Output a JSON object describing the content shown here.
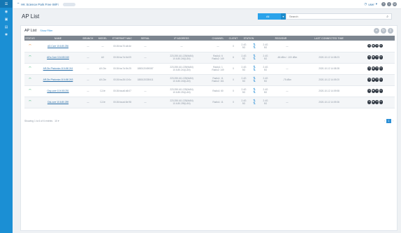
{
  "sidebar": {
    "items": [
      "nav-1",
      "nav-2",
      "nav-3",
      "nav-4",
      "nav-5"
    ]
  },
  "topbar": {
    "site": "HK Science Park Free WiFi",
    "user": "user"
  },
  "header": {
    "title": "AP List",
    "select_value": "All",
    "search_placeholder": "Search"
  },
  "panel": {
    "title": "AP List",
    "filter": "Show Filter"
  },
  "columns": [
    "STATUS",
    "NAME",
    "BRANCH",
    "MODEL",
    "ETHERNET MAC",
    "SERIAL",
    "IP ADDRESS",
    "CHANNEL",
    "CLIENT",
    "STATION",
    "",
    "RSSI/SNR",
    "",
    "LAST CONNECTED TIME",
    ""
  ],
  "rows": [
    {
      "status": "warn",
      "name": "AD-Core 10.6.80.236",
      "branch": "—",
      "model": "—",
      "mac": "00:26:ba:70:d4:6e",
      "serial": "—",
      "ip1": "—",
      "ip2": "",
      "ch1": "—",
      "ch2": "",
      "client": "0",
      "st1": "2.4G",
      "st2": "5G",
      "rssi1": "2.4G",
      "rssi2": "5G",
      "snr": "—",
      "last": ""
    },
    {
      "status": "ok",
      "name": "ADv-Core 10.6.80.240",
      "branch": "—",
      "model": "AX",
      "mac": "00:26:ba:7d:0d:09",
      "serial": "—",
      "ip1": "223.255.161.225(WAN)",
      "ip2": "10.6.80.240(LAN)",
      "ch1": "Radio1: 6",
      "ch2": "Radio2: 149",
      "client": "6",
      "st1": "2.4G",
      "st2": "5G",
      "rssi1": "2.4G",
      "rssi2": "5G",
      "snr": "-66 dBm / -100 dBm",
      "last": "2020-10-12 14:08:23"
    },
    {
      "status": "ok",
      "name": "AR-Dix Photonics 10.6.80.241",
      "branch": "—",
      "model": "AX-Dix",
      "mac": "00:26:ba:7d:0b:25",
      "serial": "1880120490087",
      "ip1": "223.255.161.225(WAN)",
      "ip2": "10.6.80.241(LAN)",
      "ch1": "Radio1: 1",
      "ch2": "Radio2: 149",
      "client": "0",
      "st1": "2.4G",
      "st2": "5G",
      "rssi1": "2.4G",
      "rssi2": "5G",
      "snr": "—",
      "last": "2020-10-12 14:08:38"
    },
    {
      "status": "ok",
      "name": "AR-Dix Photonics 10.6.80.243",
      "branch": "—",
      "model": "AX-Dix",
      "mac": "00:26:ba:26:10:0c",
      "serial": "1880120339411",
      "ip1": "223.255.161.225(WAN)",
      "ip2": "10.6.80.243(LAN)",
      "ch1": "Radio1: 11",
      "ch2": "Radio2: 161",
      "client": "0",
      "st1": "2.4G",
      "st2": "5G",
      "rssi1": "2.4G",
      "rssi2": "5G",
      "snr": "-75 dBm",
      "last": "2020-10-12 14:09:20"
    },
    {
      "status": "ok",
      "name": "Cisp-core 10.6.80.251",
      "branch": "—",
      "model": "CJ-fe",
      "mac": "00:26:ba:a6:d6:07",
      "serial": "—",
      "ip1": "223.255.161.225(WAN)",
      "ip2": "10.6.80.251(LAN)",
      "ch1": "Radio1: 60",
      "ch2": "",
      "client": "0",
      "st1": "2.4G",
      "st2": "5G",
      "rssi1": "2.4G",
      "rssi2": "5G",
      "snr": "—",
      "last": "2020-10-12 14:09:58"
    },
    {
      "status": "ok",
      "name": "Cisi-core 10.6.80.259",
      "branch": "—",
      "model": "CJ-fe",
      "mac": "00:26:ba:ad:6e:98",
      "serial": "—",
      "ip1": "223.255.161.225(WAN)",
      "ip2": "10.6.80.259(LAN)",
      "ch1": "Radio1: 11",
      "ch2": "",
      "client": "0",
      "st1": "2.4G",
      "st2": "5G",
      "rssi1": "2.4G",
      "rssi2": "5G",
      "snr": "—",
      "last": "2020-10-12 14:09:36"
    }
  ],
  "footer": {
    "showing": "Showing 1 to 6 of 6 entries",
    "page_size": "10",
    "current_page": "1"
  },
  "colors": {
    "sidebar": "#1b8fd4",
    "accent": "#2ba3ea",
    "table_header": "#7c858f",
    "ok": "#2fae6b",
    "warn": "#e5802a"
  }
}
